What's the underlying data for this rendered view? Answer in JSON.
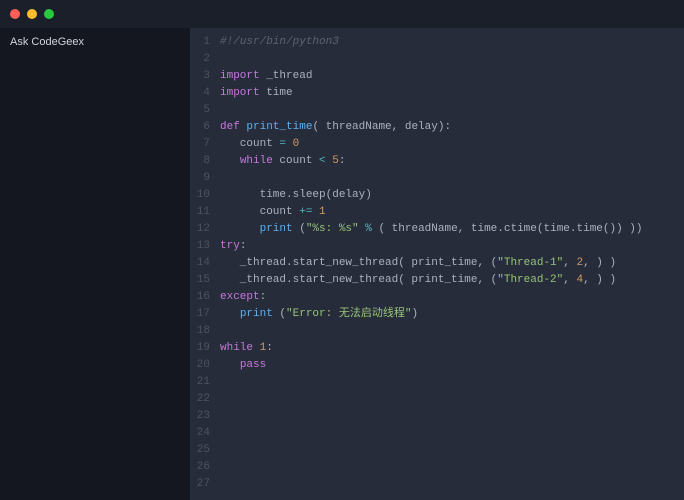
{
  "titlebar": {},
  "sidebar": {
    "ask_label": "Ask CodeGeex"
  },
  "editor": {
    "lines": [
      {
        "n": 1,
        "tokens": [
          [
            "cm",
            "#!/usr/bin/python3"
          ]
        ]
      },
      {
        "n": 2,
        "tokens": []
      },
      {
        "n": 3,
        "tokens": [
          [
            "kw",
            "import"
          ],
          [
            "pl",
            " _thread"
          ]
        ]
      },
      {
        "n": 4,
        "tokens": [
          [
            "kw",
            "import"
          ],
          [
            "pl",
            " time"
          ]
        ]
      },
      {
        "n": 5,
        "tokens": []
      },
      {
        "n": 6,
        "tokens": [
          [
            "kw",
            "def"
          ],
          [
            "pl",
            " "
          ],
          [
            "fn",
            "print_time"
          ],
          [
            "pl",
            "( threadName, delay):"
          ]
        ]
      },
      {
        "n": 7,
        "tokens": [
          [
            "pl",
            "   count "
          ],
          [
            "op",
            "="
          ],
          [
            "pl",
            " "
          ],
          [
            "num",
            "0"
          ]
        ]
      },
      {
        "n": 8,
        "tokens": [
          [
            "pl",
            "   "
          ],
          [
            "kw",
            "while"
          ],
          [
            "pl",
            " count "
          ],
          [
            "op",
            "<"
          ],
          [
            "pl",
            " "
          ],
          [
            "num",
            "5"
          ],
          [
            "pl",
            ":"
          ]
        ]
      },
      {
        "n": 9,
        "tokens": []
      },
      {
        "n": 10,
        "tokens": [
          [
            "pl",
            "      time.sleep(delay)"
          ]
        ]
      },
      {
        "n": 11,
        "tokens": [
          [
            "pl",
            "      count "
          ],
          [
            "op",
            "+="
          ],
          [
            "pl",
            " "
          ],
          [
            "num",
            "1"
          ]
        ]
      },
      {
        "n": 12,
        "tokens": [
          [
            "pl",
            "      "
          ],
          [
            "fn",
            "print"
          ],
          [
            "pl",
            " ("
          ],
          [
            "str",
            "\"%s: %s\""
          ],
          [
            "pl",
            " "
          ],
          [
            "op",
            "%"
          ],
          [
            "pl",
            " ( threadName, time.ctime(time.time()) ))"
          ]
        ]
      },
      {
        "n": 13,
        "tokens": [
          [
            "kw",
            "try"
          ],
          [
            "pl",
            ":"
          ]
        ]
      },
      {
        "n": 14,
        "tokens": [
          [
            "pl",
            "   _thread.start_new_thread( print_time, ("
          ],
          [
            "str",
            "\"Thread-1\""
          ],
          [
            "pl",
            ", "
          ],
          [
            "num",
            "2"
          ],
          [
            "pl",
            ", ) )"
          ]
        ]
      },
      {
        "n": 15,
        "tokens": [
          [
            "pl",
            "   _thread.start_new_thread( print_time, ("
          ],
          [
            "str",
            "\"Thread-2\""
          ],
          [
            "pl",
            ", "
          ],
          [
            "num",
            "4"
          ],
          [
            "pl",
            ", ) )"
          ]
        ]
      },
      {
        "n": 16,
        "tokens": [
          [
            "kw",
            "except"
          ],
          [
            "pl",
            ":"
          ]
        ]
      },
      {
        "n": 17,
        "tokens": [
          [
            "pl",
            "   "
          ],
          [
            "fn",
            "print"
          ],
          [
            "pl",
            " ("
          ],
          [
            "str",
            "\"Error: 无法启动线程\""
          ],
          [
            "pl",
            ")"
          ]
        ]
      },
      {
        "n": 18,
        "tokens": []
      },
      {
        "n": 19,
        "tokens": [
          [
            "kw",
            "while"
          ],
          [
            "pl",
            " "
          ],
          [
            "num",
            "1"
          ],
          [
            "pl",
            ":"
          ]
        ]
      },
      {
        "n": 20,
        "tokens": [
          [
            "pl",
            "   "
          ],
          [
            "kw",
            "pass"
          ]
        ]
      },
      {
        "n": 21,
        "tokens": []
      },
      {
        "n": 22,
        "tokens": []
      },
      {
        "n": 23,
        "tokens": []
      },
      {
        "n": 24,
        "tokens": []
      },
      {
        "n": 25,
        "tokens": []
      },
      {
        "n": 26,
        "tokens": []
      },
      {
        "n": 27,
        "tokens": []
      }
    ]
  }
}
